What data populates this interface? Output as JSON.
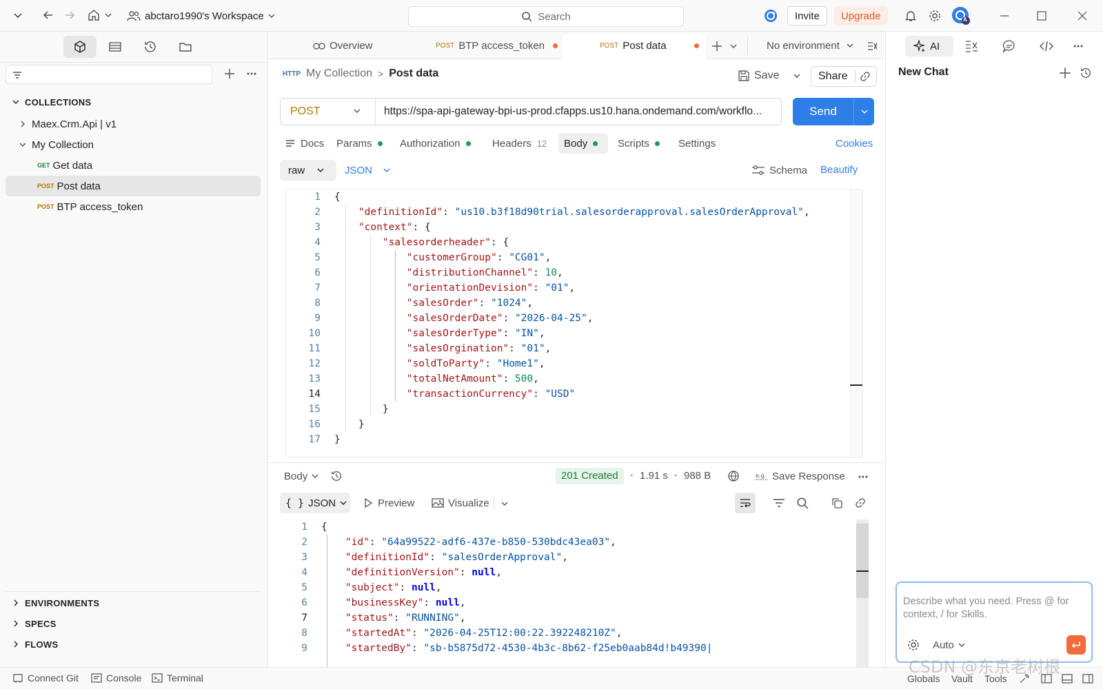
{
  "titlebar": {
    "workspace": "abctaro1990's Workspace",
    "search_placeholder": "Search",
    "invite": "Invite",
    "upgrade": "Upgrade",
    "avatar_badge": "A"
  },
  "sidebar": {
    "collections_header": "COLLECTIONS",
    "tree": [
      {
        "label": "Maex.Crm.Api | v1"
      },
      {
        "label": "My Collection"
      }
    ],
    "requests": [
      {
        "method": "GET",
        "label": "Get data"
      },
      {
        "method": "POST",
        "label": "Post data"
      },
      {
        "method": "POST",
        "label": "BTP access_token"
      }
    ],
    "sections": [
      "ENVIRONMENTS",
      "SPECS",
      "FLOWS"
    ]
  },
  "tabs": {
    "overview": "Overview",
    "tab1_method": "POST",
    "tab1_label": "BTP access_token",
    "tab2_method": "POST",
    "tab2_label": "Post data",
    "environment": "No environment"
  },
  "request": {
    "icon_label": "HTTP",
    "breadcrumb_collection": "My Collection",
    "breadcrumb_sep": ">",
    "breadcrumb_request": "Post data",
    "save": "Save",
    "share": "Share",
    "method": "POST",
    "url": "https://spa-api-gateway-bpi-us-prod.cfapps.us10.hana.ondemand.com/workflo...",
    "send": "Send",
    "subtabs": {
      "docs": "Docs",
      "params": "Params",
      "authorization": "Authorization",
      "headers": "Headers",
      "headers_count": "12",
      "body": "Body",
      "scripts": "Scripts",
      "settings": "Settings",
      "cookies": "Cookies"
    },
    "body_mode": "raw",
    "body_format": "JSON",
    "schema": "Schema",
    "beautify": "Beautify"
  },
  "response": {
    "body_label": "Body",
    "status": "201 Created",
    "time": "1.91 s",
    "size": "988 B",
    "save_response": "Save Response",
    "format": "JSON",
    "preview": "Preview",
    "visualize": "Visualize"
  },
  "ai_panel": {
    "ai_tab": "AI",
    "title": "New Chat",
    "input_placeholder": "Describe what you need. Press @ for context, / for Skills.",
    "mode": "Auto"
  },
  "statusbar": {
    "connect_git": "Connect Git",
    "console": "Console",
    "terminal": "Terminal",
    "globals": "Globals",
    "vault": "Vault",
    "tools": "Tools"
  },
  "watermark": "CSDN @东京老树根",
  "colors": {
    "accent_blue": "#2d7ee6",
    "upgrade_orange": "#e05a2b",
    "status_green": "#1a7f37",
    "tab_dot_orange": "#f26b3a",
    "send_orange": "#f26b3a"
  }
}
